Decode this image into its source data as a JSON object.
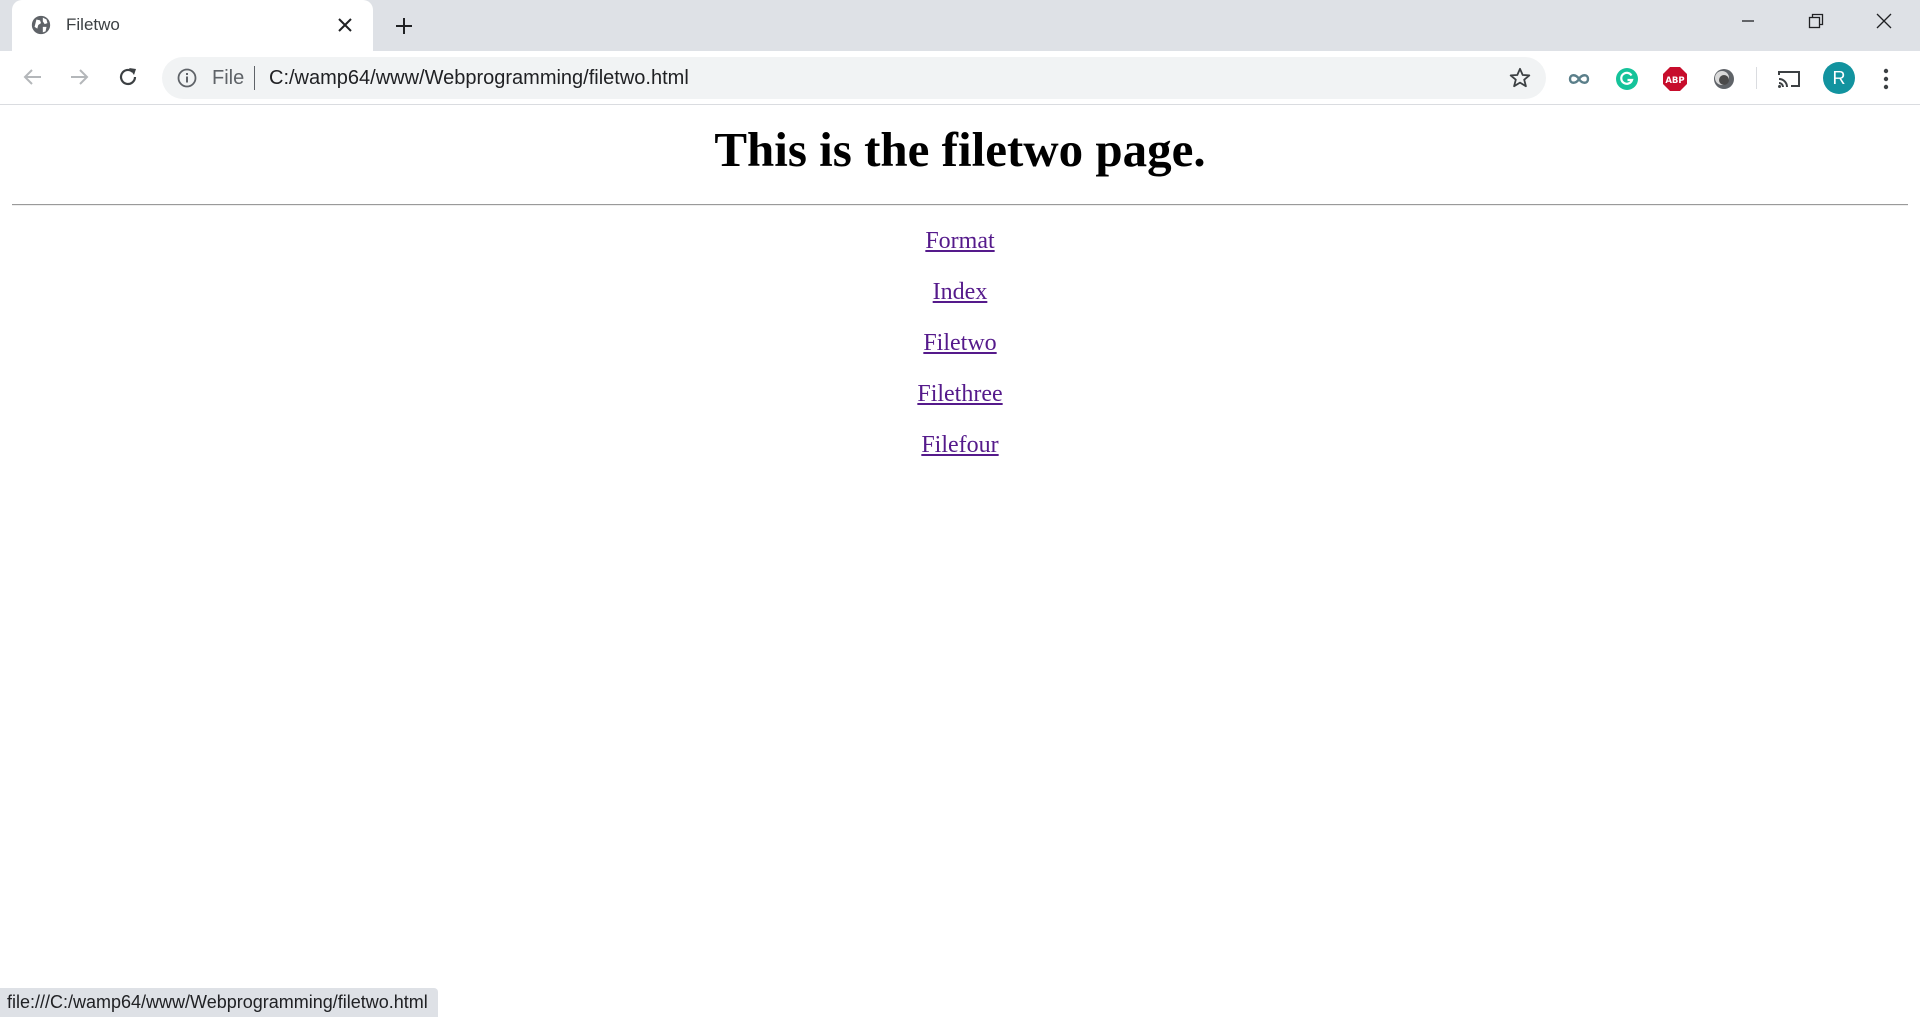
{
  "browser": {
    "tab": {
      "title": "Filetwo"
    },
    "omnibox": {
      "scheme_label": "File",
      "url": "C:/wamp64/www/Webprogramming/filetwo.html"
    },
    "avatar_letter": "R",
    "extensions": [
      "infinity-extension-icon",
      "grammarly-icon",
      "adblock-plus-icon",
      "orb-extension-icon"
    ],
    "status_url": "file:///C:/wamp64/www/Webprogramming/filetwo.html"
  },
  "page": {
    "heading": "This is the filetwo page.",
    "links": [
      "Format",
      "Index",
      "Filetwo",
      "Filethree",
      "Filefour"
    ]
  },
  "colors": {
    "link": "#551a8b",
    "avatar_bg": "#12939f",
    "grammarly": "#15c39a",
    "abp": "#c70d2c"
  }
}
